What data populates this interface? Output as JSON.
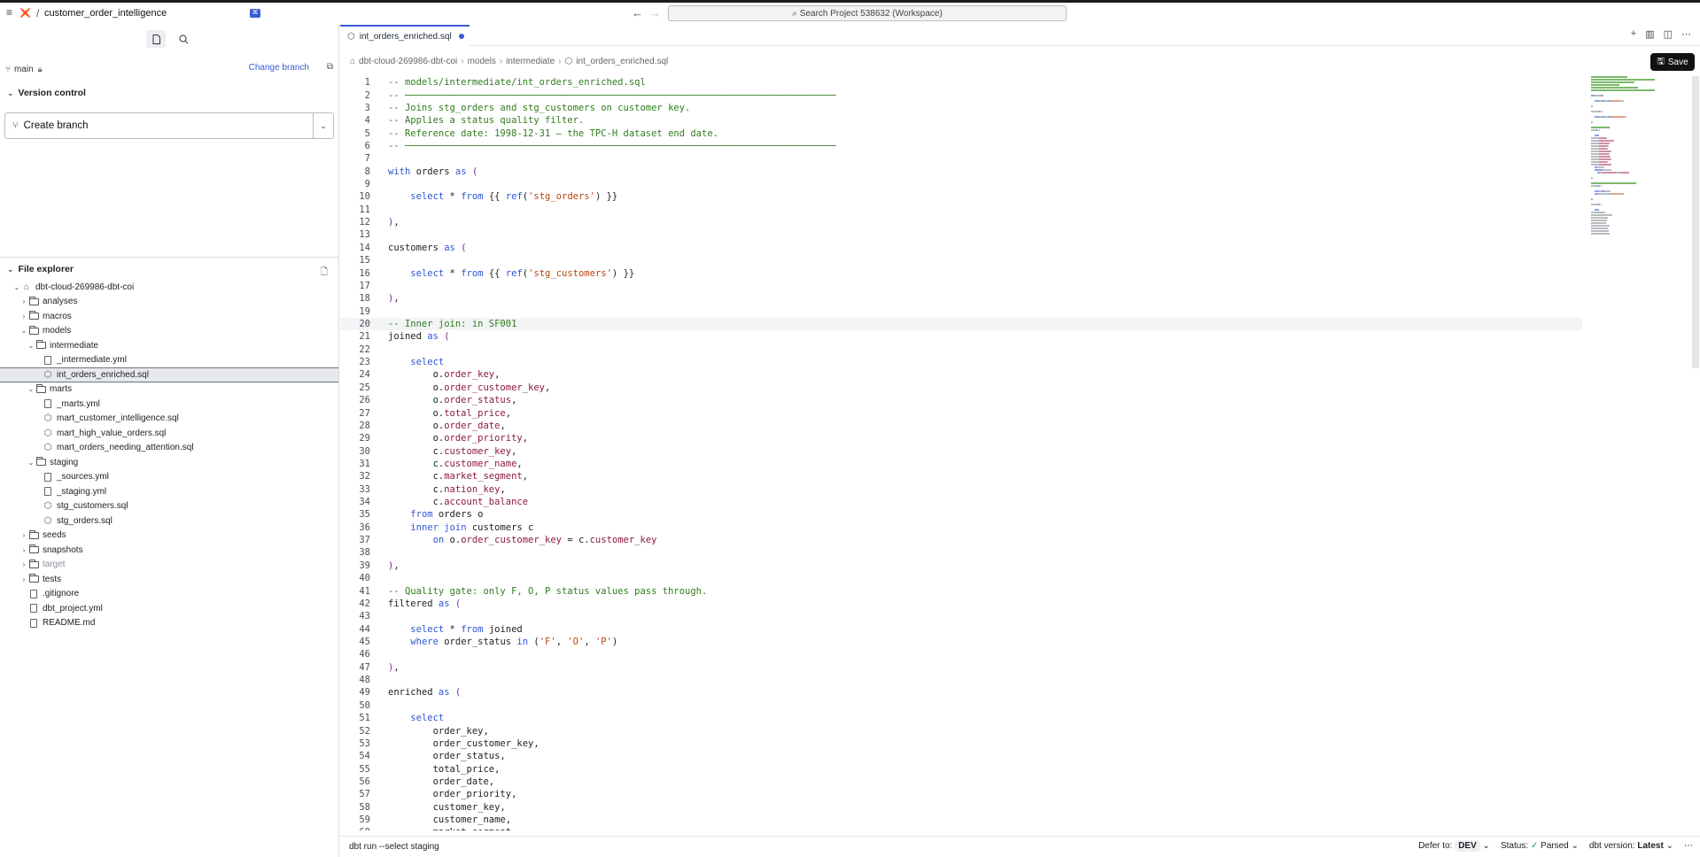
{
  "app": {
    "project_name": "customer_order_intelligence",
    "kbd_badge": "⌘",
    "search_placeholder": "Search Project 538632 (Workspace)"
  },
  "left_panel": {
    "branch": "main",
    "change_branch_label": "Change branch",
    "version_control_title": "Version control",
    "create_branch_label": "Create branch",
    "file_explorer_title": "File explorer"
  },
  "file_tree": [
    {
      "label": "dbt-cloud-269986-dbt-coi",
      "depth": 0,
      "type": "root",
      "open": true
    },
    {
      "label": "analyses",
      "depth": 1,
      "type": "folder",
      "open": false
    },
    {
      "label": "macros",
      "depth": 1,
      "type": "folder",
      "open": false
    },
    {
      "label": "models",
      "depth": 1,
      "type": "folder",
      "open": true
    },
    {
      "label": "intermediate",
      "depth": 2,
      "type": "folder",
      "open": true
    },
    {
      "label": "_intermediate.yml",
      "depth": 3,
      "type": "file"
    },
    {
      "label": "int_orders_enriched.sql",
      "depth": 3,
      "type": "model",
      "selected": true
    },
    {
      "label": "marts",
      "depth": 2,
      "type": "folder",
      "open": true
    },
    {
      "label": "_marts.yml",
      "depth": 3,
      "type": "file"
    },
    {
      "label": "mart_customer_intelligence.sql",
      "depth": 3,
      "type": "model"
    },
    {
      "label": "mart_high_value_orders.sql",
      "depth": 3,
      "type": "model"
    },
    {
      "label": "mart_orders_needing_attention.sql",
      "depth": 3,
      "type": "model"
    },
    {
      "label": "staging",
      "depth": 2,
      "type": "folder",
      "open": true
    },
    {
      "label": "_sources.yml",
      "depth": 3,
      "type": "file"
    },
    {
      "label": "_staging.yml",
      "depth": 3,
      "type": "file"
    },
    {
      "label": "stg_customers.sql",
      "depth": 3,
      "type": "model"
    },
    {
      "label": "stg_orders.sql",
      "depth": 3,
      "type": "model"
    },
    {
      "label": "seeds",
      "depth": 1,
      "type": "folder",
      "open": false
    },
    {
      "label": "snapshots",
      "depth": 1,
      "type": "folder",
      "open": false
    },
    {
      "label": "target",
      "depth": 1,
      "type": "folder",
      "open": false,
      "dim": true
    },
    {
      "label": "tests",
      "depth": 1,
      "type": "folder",
      "open": false
    },
    {
      "label": ".gitignore",
      "depth": 1,
      "type": "file"
    },
    {
      "label": "dbt_project.yml",
      "depth": 1,
      "type": "file"
    },
    {
      "label": "README.md",
      "depth": 1,
      "type": "file"
    }
  ],
  "editor": {
    "tab_label": "int_orders_enriched.sql",
    "breadcrumb": [
      "dbt-cloud-269986-dbt-coi",
      "models",
      "intermediate",
      "int_orders_enriched.sql"
    ],
    "save_label": "Save",
    "current_line": 20,
    "lines": [
      [
        [
          "c",
          "-- models/intermediate/int_orders_enriched.sql"
        ]
      ],
      [
        [
          "c",
          "-- ─────────────────────────────────────────────────────────────────────────────"
        ]
      ],
      [
        [
          "c",
          "-- Joins stg_orders and stg_customers on customer key."
        ]
      ],
      [
        [
          "c",
          "-- Applies a status quality filter."
        ]
      ],
      [
        [
          "c",
          "-- Reference date: 1998-12-31 — the TPC-H dataset end date."
        ]
      ],
      [
        [
          "c",
          "-- ─────────────────────────────────────────────────────────────────────────────"
        ]
      ],
      [],
      [
        [
          "k",
          "with"
        ],
        [
          "n",
          " orders "
        ],
        [
          "k",
          "as"
        ],
        [
          "n",
          " "
        ],
        [
          "p",
          "("
        ]
      ],
      [],
      [
        [
          "n",
          "    "
        ],
        [
          "k",
          "select"
        ],
        [
          "n",
          " * "
        ],
        [
          "k",
          "from"
        ],
        [
          "n",
          " {{ "
        ],
        [
          "f",
          "ref"
        ],
        [
          "n",
          "("
        ],
        [
          "s",
          "'stg_orders'"
        ],
        [
          "n",
          ") }}"
        ]
      ],
      [],
      [
        [
          "p",
          ")"
        ],
        [
          "n",
          ","
        ]
      ],
      [],
      [
        [
          "n",
          "customers "
        ],
        [
          "k",
          "as"
        ],
        [
          "n",
          " "
        ],
        [
          "p",
          "("
        ]
      ],
      [],
      [
        [
          "n",
          "    "
        ],
        [
          "k",
          "select"
        ],
        [
          "n",
          " * "
        ],
        [
          "k",
          "from"
        ],
        [
          "n",
          " {{ "
        ],
        [
          "f",
          "ref"
        ],
        [
          "n",
          "("
        ],
        [
          "s",
          "'stg_customers'"
        ],
        [
          "n",
          ") }}"
        ]
      ],
      [],
      [
        [
          "p",
          ")"
        ],
        [
          "n",
          ","
        ]
      ],
      [],
      [
        [
          "c",
          "-- Inner join: in SF001"
        ]
      ],
      [
        [
          "n",
          "joined "
        ],
        [
          "k",
          "as"
        ],
        [
          "n",
          " "
        ],
        [
          "p",
          "("
        ]
      ],
      [],
      [
        [
          "n",
          "    "
        ],
        [
          "k",
          "select"
        ]
      ],
      [
        [
          "n",
          "        o."
        ],
        [
          "i",
          "order_key"
        ],
        [
          "n",
          ","
        ]
      ],
      [
        [
          "n",
          "        o."
        ],
        [
          "i",
          "order_customer_key"
        ],
        [
          "n",
          ","
        ]
      ],
      [
        [
          "n",
          "        o."
        ],
        [
          "i",
          "order_status"
        ],
        [
          "n",
          ","
        ]
      ],
      [
        [
          "n",
          "        o."
        ],
        [
          "i",
          "total_price"
        ],
        [
          "n",
          ","
        ]
      ],
      [
        [
          "n",
          "        o."
        ],
        [
          "i",
          "order_date"
        ],
        [
          "n",
          ","
        ]
      ],
      [
        [
          "n",
          "        o."
        ],
        [
          "i",
          "order_priority"
        ],
        [
          "n",
          ","
        ]
      ],
      [
        [
          "n",
          "        c."
        ],
        [
          "i",
          "customer_key"
        ],
        [
          "n",
          ","
        ]
      ],
      [
        [
          "n",
          "        c."
        ],
        [
          "i",
          "customer_name"
        ],
        [
          "n",
          ","
        ]
      ],
      [
        [
          "n",
          "        c."
        ],
        [
          "i",
          "market_segment"
        ],
        [
          "n",
          ","
        ]
      ],
      [
        [
          "n",
          "        c."
        ],
        [
          "i",
          "nation_key"
        ],
        [
          "n",
          ","
        ]
      ],
      [
        [
          "n",
          "        c."
        ],
        [
          "i",
          "account_balance"
        ]
      ],
      [
        [
          "n",
          "    "
        ],
        [
          "k",
          "from"
        ],
        [
          "n",
          " orders o"
        ]
      ],
      [
        [
          "n",
          "    "
        ],
        [
          "k",
          "inner join"
        ],
        [
          "n",
          " customers c"
        ]
      ],
      [
        [
          "n",
          "        "
        ],
        [
          "k",
          "on"
        ],
        [
          "n",
          " o."
        ],
        [
          "i",
          "order_customer_key"
        ],
        [
          "n",
          " = c."
        ],
        [
          "i",
          "customer_key"
        ]
      ],
      [],
      [
        [
          "p",
          ")"
        ],
        [
          "n",
          ","
        ]
      ],
      [],
      [
        [
          "c",
          "-- Quality gate: only F, O, P status values pass through."
        ]
      ],
      [
        [
          "n",
          "filtered "
        ],
        [
          "k",
          "as"
        ],
        [
          "n",
          " "
        ],
        [
          "p",
          "("
        ]
      ],
      [],
      [
        [
          "n",
          "    "
        ],
        [
          "k",
          "select"
        ],
        [
          "n",
          " * "
        ],
        [
          "k",
          "from"
        ],
        [
          "n",
          " joined"
        ]
      ],
      [
        [
          "n",
          "    "
        ],
        [
          "k",
          "where"
        ],
        [
          "n",
          " order_status "
        ],
        [
          "k",
          "in"
        ],
        [
          "n",
          " ("
        ],
        [
          "s",
          "'F'"
        ],
        [
          "n",
          ", "
        ],
        [
          "s",
          "'O'"
        ],
        [
          "n",
          ", "
        ],
        [
          "s",
          "'P'"
        ],
        [
          "n",
          ")"
        ]
      ],
      [],
      [
        [
          "p",
          ")"
        ],
        [
          "n",
          ","
        ]
      ],
      [],
      [
        [
          "n",
          "enriched "
        ],
        [
          "k",
          "as"
        ],
        [
          "n",
          " "
        ],
        [
          "p",
          "("
        ]
      ],
      [],
      [
        [
          "n",
          "    "
        ],
        [
          "k",
          "select"
        ]
      ],
      [
        [
          "n",
          "        order_key,"
        ]
      ],
      [
        [
          "n",
          "        order_customer_key,"
        ]
      ],
      [
        [
          "n",
          "        order_status,"
        ]
      ],
      [
        [
          "n",
          "        total_price,"
        ]
      ],
      [
        [
          "n",
          "        order_date,"
        ]
      ],
      [
        [
          "n",
          "        order_priority,"
        ]
      ],
      [
        [
          "n",
          "        customer_key,"
        ]
      ],
      [
        [
          "n",
          "        customer_name,"
        ]
      ],
      [
        [
          "n",
          "        market_segment,"
        ]
      ]
    ]
  },
  "statusbar": {
    "command": "dbt run --select staging",
    "defer_label": "Defer to:",
    "defer_value": "DEV",
    "status_label": "Status:",
    "status_value": "Parsed",
    "version_label": "dbt version:",
    "version_value": "Latest",
    "more": "⋯"
  },
  "colors": {
    "accent": "#3b5bd6",
    "comment": "#2e7d1c",
    "keyword": "#2f55d4",
    "string": "#b8430b",
    "identifier": "#8b1a3c"
  }
}
